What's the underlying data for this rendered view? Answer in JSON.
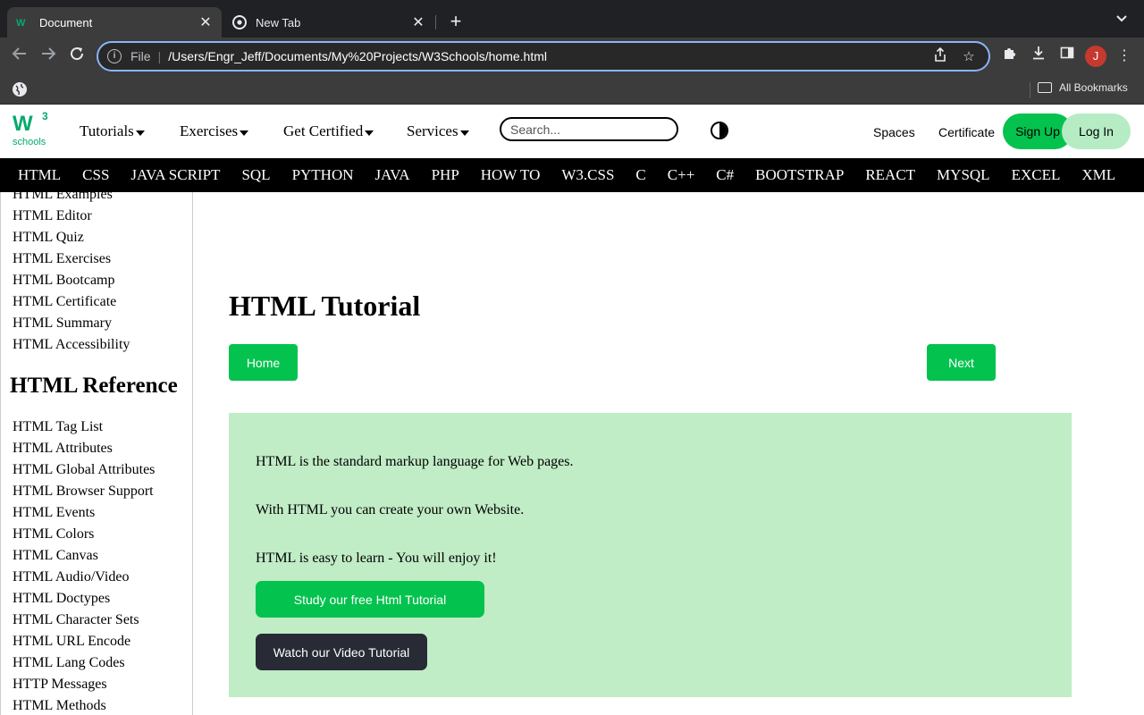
{
  "browser": {
    "tabs": [
      {
        "title": "Document",
        "active": true
      },
      {
        "title": "New Tab",
        "active": false
      }
    ],
    "address": {
      "scheme": "File",
      "url": "/Users/Engr_Jeff/Documents/My%20Projects/W3Schools/home.html"
    },
    "profile_initial": "J",
    "bookmarks_label": "All Bookmarks"
  },
  "site_header": {
    "logo": {
      "mark": "W",
      "superscript": "3",
      "text": "schools"
    },
    "menu": [
      "Tutorials",
      "Exercises",
      "Get Certified",
      "Services"
    ],
    "search_placeholder": "Search...",
    "links": [
      "Spaces",
      "Certificate"
    ],
    "signup_label": "Sign Up",
    "login_label": "Log In"
  },
  "topics": [
    "HTML",
    "CSS",
    "JAVA SCRIPT",
    "SQL",
    "PYTHON",
    "JAVA",
    "PHP",
    "HOW TO",
    "W3.CSS",
    "C",
    "C++",
    "C#",
    "BOOTSTRAP",
    "REACT",
    "MYSQL",
    "EXCEL",
    "XML"
  ],
  "sidebar": {
    "links_top": [
      "HTML Examples",
      "HTML Editor",
      "HTML Quiz",
      "HTML Exercises",
      "HTML Bootcamp",
      "HTML Certificate",
      "HTML Summary",
      "HTML Accessibility"
    ],
    "reference_heading": "HTML Reference",
    "links_reference": [
      "HTML Tag List",
      "HTML Attributes",
      "HTML Global Attributes",
      "HTML Browser Support",
      "HTML Events",
      "HTML Colors",
      "HTML Canvas",
      "HTML Audio/Video",
      "HTML Doctypes",
      "HTML Character Sets",
      "HTML URL Encode",
      "HTML Lang Codes",
      "HTTP Messages",
      "HTML Methods"
    ]
  },
  "main": {
    "title": "HTML Tutorial",
    "home_label": "Home",
    "next_label": "Next",
    "hero": {
      "lines": [
        "HTML is the standard markup language for Web pages.",
        "With HTML you can create your own Website.",
        "HTML is easy to learn - You will enjoy it!"
      ],
      "study_label": "Study our free Html Tutorial",
      "video_label": "Watch our Video Tutorial"
    }
  },
  "colors": {
    "brand_green": "#04c24e",
    "hero_bg": "#c0ecc6",
    "dark_button": "#282a35"
  }
}
